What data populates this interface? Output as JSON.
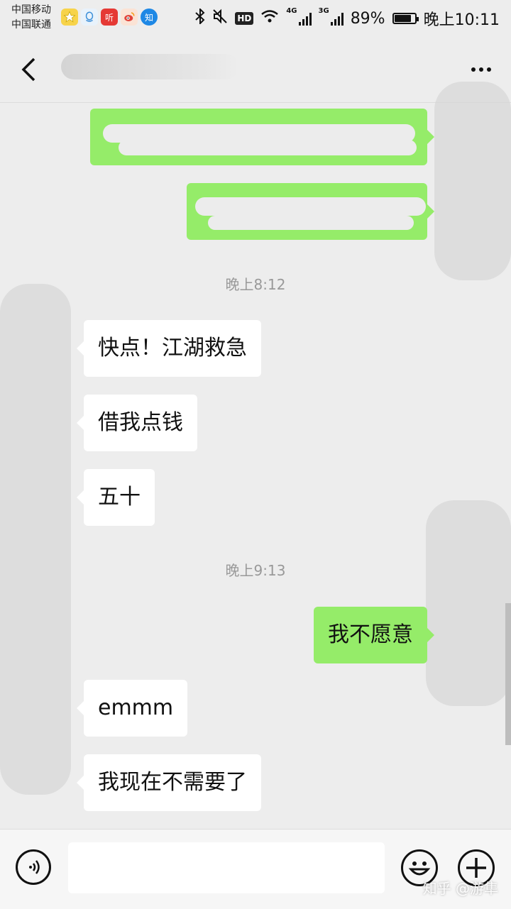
{
  "status_bar": {
    "carrier_1": "中国移动",
    "carrier_2": "中国联通",
    "app_icons": [
      "star-icon",
      "qq-icon",
      "ting-icon",
      "weibo-icon",
      "zhihu-icon"
    ],
    "icon_glyph_ting": "听",
    "icon_glyph_zhihu": "知",
    "bluetooth_icon": "bluetooth-icon",
    "mute_icon": "mute-icon",
    "hd_label": "HD",
    "net_1": "4G",
    "net_2": "3G",
    "battery_percent": "89%",
    "battery_level": 0.89,
    "time": "晚上10:11"
  },
  "nav": {
    "back_icon": "chevron-left-icon",
    "more_icon": "more-icon"
  },
  "timestamps": [
    "晚上8:12",
    "晚上9:13"
  ],
  "messages": [
    {
      "from": "me",
      "text": ""
    },
    {
      "from": "me",
      "text": ""
    },
    {
      "from": "friend",
      "text": "快点！江湖救急"
    },
    {
      "from": "friend",
      "text": "借我点钱"
    },
    {
      "from": "friend",
      "text": "五十"
    },
    {
      "from": "me",
      "text": "我不愿意"
    },
    {
      "from": "friend",
      "text": "emmm"
    },
    {
      "from": "friend",
      "text": "我现在不需要了"
    }
  ],
  "input_bar": {
    "voice_icon": "voice-icon",
    "emoji_icon": "emoji-icon",
    "plus_icon": "plus-icon",
    "placeholder": ""
  },
  "watermark": "知乎 @游隼",
  "colors": {
    "background": "#ededed",
    "sent_bubble": "#95ec69",
    "received_bubble": "#ffffff",
    "timestamp": "#999999"
  }
}
